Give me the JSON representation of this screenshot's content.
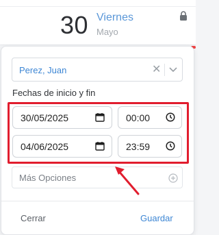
{
  "calendar": {
    "day_number": "30",
    "weekday": "Viernes",
    "month": "Mayo"
  },
  "form": {
    "person_value": "Perez, Juan",
    "dates_label": "Fechas de inicio y fin",
    "start_date": "30/05/2025",
    "start_time": "00:00",
    "end_date": "04/06/2025",
    "end_time": "23:59",
    "more_options_label": "Más Opciones"
  },
  "footer": {
    "close_label": "Cerrar",
    "save_label": "Guardar"
  },
  "colors": {
    "accent": "#3d86d4",
    "highlight": "#e11d2e"
  },
  "icons": [
    "lock-icon",
    "clear-icon",
    "chevron-down-icon",
    "calendar-icon",
    "clock-icon",
    "plus-circle-icon",
    "arrow-annotation"
  ]
}
